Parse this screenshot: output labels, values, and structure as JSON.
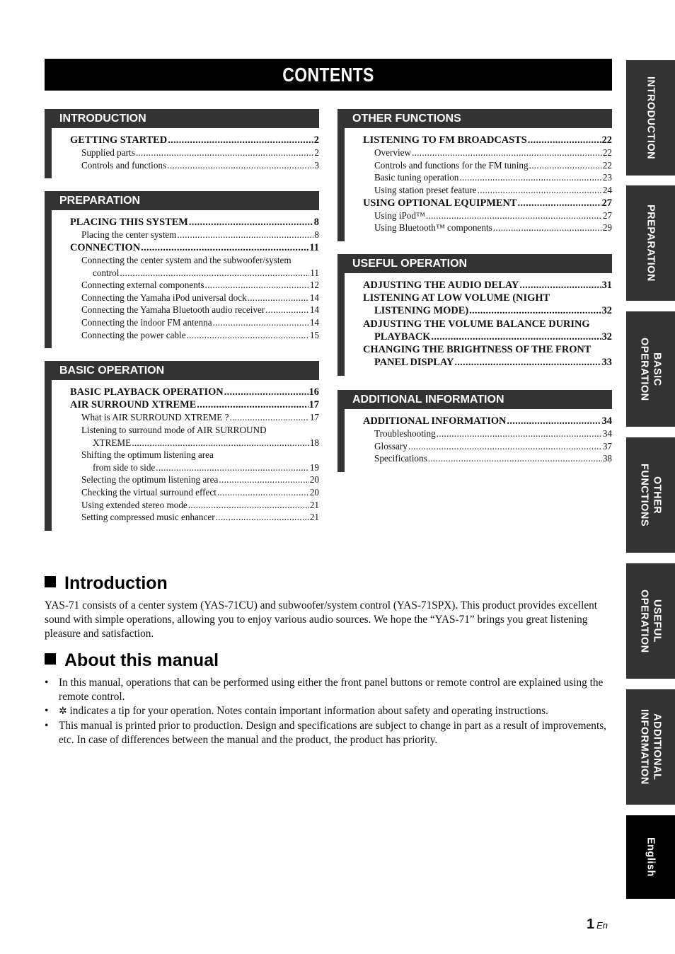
{
  "page_title": "CONTENTS",
  "toc": {
    "left": [
      {
        "header": "INTRODUCTION",
        "entries": [
          {
            "level": "main",
            "text": "GETTING STARTED",
            "page": "2"
          },
          {
            "level": "sub",
            "text": "Supplied parts",
            "page": "2"
          },
          {
            "level": "sub",
            "text": "Controls and functions",
            "page": "3"
          }
        ]
      },
      {
        "header": "PREPARATION",
        "entries": [
          {
            "level": "main",
            "text": "PLACING THIS SYSTEM",
            "page": "8"
          },
          {
            "level": "sub",
            "text": "Placing the center system",
            "page": "8"
          },
          {
            "level": "main",
            "text": "CONNECTION",
            "page": "11"
          },
          {
            "level": "sub-nopage",
            "text": "Connecting the center system and the subwoofer/system",
            "page": ""
          },
          {
            "level": "cont",
            "text": "control",
            "page": "11"
          },
          {
            "level": "sub",
            "text": "Connecting external components",
            "page": "12"
          },
          {
            "level": "sub",
            "text": "Connecting the Yamaha iPod universal dock",
            "page": "14"
          },
          {
            "level": "sub",
            "text": "Connecting the Yamaha Bluetooth audio receiver",
            "page": "14"
          },
          {
            "level": "sub",
            "text": "Connecting the indoor FM antenna",
            "page": "14"
          },
          {
            "level": "sub",
            "text": "Connecting the power cable",
            "page": "15"
          }
        ]
      },
      {
        "header": "BASIC OPERATION",
        "entries": [
          {
            "level": "main",
            "text": "BASIC PLAYBACK OPERATION",
            "page": "16"
          },
          {
            "level": "main",
            "text": "AIR SURROUND XTREME",
            "page": "17"
          },
          {
            "level": "sub",
            "text": "What is AIR SURROUND XTREME ?",
            "page": "17"
          },
          {
            "level": "sub-nopage",
            "text": "Listening to surround mode of AIR SURROUND",
            "page": ""
          },
          {
            "level": "cont",
            "text": "XTREME",
            "page": "18"
          },
          {
            "level": "sub-nopage",
            "text": "Shifting the optimum listening area",
            "page": ""
          },
          {
            "level": "cont",
            "text": "from side to side",
            "page": "19"
          },
          {
            "level": "sub",
            "text": "Selecting the optimum listening area",
            "page": "20"
          },
          {
            "level": "sub",
            "text": "Checking the virtual surround effect",
            "page": "20"
          },
          {
            "level": "sub",
            "text": "Using extended stereo mode",
            "page": "21"
          },
          {
            "level": "sub",
            "text": "Setting compressed music enhancer",
            "page": "21"
          }
        ]
      }
    ],
    "right": [
      {
        "header": "OTHER FUNCTIONS",
        "entries": [
          {
            "level": "main",
            "text": "LISTENING TO FM BROADCASTS",
            "page": "22"
          },
          {
            "level": "sub",
            "text": "Overview",
            "page": "22"
          },
          {
            "level": "sub",
            "text": "Controls and functions for the FM tuning",
            "page": "22"
          },
          {
            "level": "sub",
            "text": "Basic tuning operation",
            "page": "23"
          },
          {
            "level": "sub",
            "text": "Using station preset feature",
            "page": "24"
          },
          {
            "level": "main",
            "text": "USING OPTIONAL EQUIPMENT",
            "page": "27"
          },
          {
            "level": "sub",
            "text": "Using iPod™",
            "page": "27"
          },
          {
            "level": "sub",
            "text": "Using Bluetooth™ components",
            "page": "29"
          }
        ]
      },
      {
        "header": "USEFUL OPERATION",
        "entries": [
          {
            "level": "main",
            "text": "ADJUSTING THE AUDIO DELAY",
            "page": "31"
          },
          {
            "level": "main-nopage",
            "text": "LISTENING AT LOW VOLUME (NIGHT",
            "page": ""
          },
          {
            "level": "main-cont",
            "text": "LISTENING MODE)",
            "page": "32"
          },
          {
            "level": "main-nopage",
            "text": "ADJUSTING THE VOLUME BALANCE DURING",
            "page": ""
          },
          {
            "level": "main-cont",
            "text": "PLAYBACK",
            "page": "32"
          },
          {
            "level": "main-nopage",
            "text": "CHANGING THE BRIGHTNESS OF THE FRONT",
            "page": ""
          },
          {
            "level": "main-cont",
            "text": "PANEL DISPLAY",
            "page": "33"
          }
        ]
      },
      {
        "header": "ADDITIONAL INFORMATION",
        "entries": [
          {
            "level": "main",
            "text": "ADDITIONAL INFORMATION",
            "page": "34"
          },
          {
            "level": "sub",
            "text": "Troubleshooting",
            "page": "34"
          },
          {
            "level": "sub",
            "text": "Glossary",
            "page": "37"
          },
          {
            "level": "sub",
            "text": "Specifications",
            "page": "38"
          }
        ]
      }
    ]
  },
  "side_tabs": [
    {
      "lines": [
        "INTRODUCTION"
      ]
    },
    {
      "lines": [
        "PREPARATION"
      ]
    },
    {
      "lines": [
        "BASIC",
        "OPERATION"
      ]
    },
    {
      "lines": [
        "OTHER",
        "FUNCTIONS"
      ]
    },
    {
      "lines": [
        "USEFUL",
        "OPERATION"
      ]
    },
    {
      "lines": [
        "ADDITIONAL",
        "INFORMATION"
      ]
    },
    {
      "lines": [
        "English"
      ],
      "active": true
    }
  ],
  "introduction": {
    "heading": "Introduction",
    "body": "YAS-71 consists of a center system (YAS-71CU) and subwoofer/system control (YAS-71SPX). This product provides excellent sound with simple operations, allowing you to enjoy various audio sources. We hope the “YAS-71” brings you great listening pleasure and satisfaction."
  },
  "about_manual": {
    "heading": "About this manual",
    "bullets": [
      {
        "text": "In this manual, operations that can be performed using either the front panel buttons or remote control are explained using the remote control."
      },
      {
        "icon": "tip-icon",
        "text": " indicates a tip for your operation. Notes contain important information about safety and operating instructions."
      },
      {
        "text": "This manual is printed prior to production. Design and specifications are subject to change in part as a result of improvements, etc. In case of differences between the manual and the product, the product has priority."
      }
    ]
  },
  "footer": {
    "page_number": "1",
    "lang": "En"
  }
}
